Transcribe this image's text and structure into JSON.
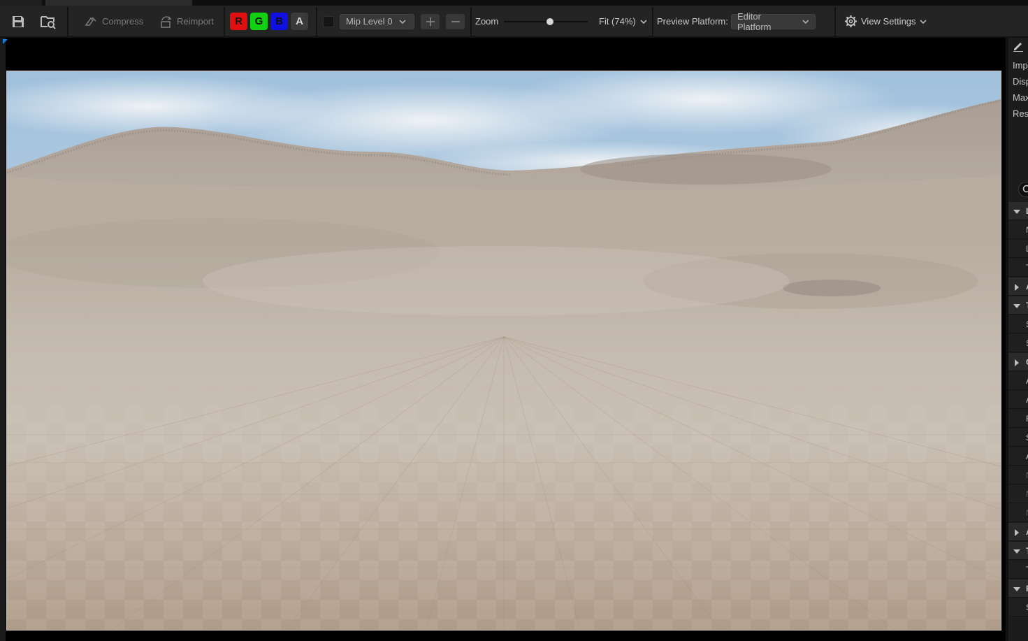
{
  "toolbar": {
    "save_icon": "save-icon",
    "browse_icon": "browse-asset-icon",
    "compress_label": "Compress",
    "reimport_label": "Reimport",
    "channels": {
      "r": "R",
      "g": "G",
      "b": "B",
      "a": "A"
    },
    "mip_level": "Mip Level 0",
    "zoom_label": "Zoom",
    "zoom_value": "Fit (74%)",
    "zoom_slider_fraction": 0.55,
    "preview_platform_label": "Preview Platform:",
    "preview_platform_value": "Editor Platform",
    "view_settings_label": "View Settings"
  },
  "details": {
    "info_rows": [
      "Imp",
      "Disp",
      "Max",
      "Res"
    ],
    "rows": [
      {
        "kind": "cat",
        "open": true,
        "ch": "L"
      },
      {
        "kind": "prop",
        "ch": "N"
      },
      {
        "kind": "prop",
        "ch": "L"
      },
      {
        "kind": "prop",
        "ch": "T"
      },
      {
        "kind": "cat",
        "open": false,
        "ch": "A"
      },
      {
        "kind": "cat",
        "open": true,
        "ch": "T"
      },
      {
        "kind": "prop",
        "ch": "S"
      },
      {
        "kind": "prop",
        "ch": "S"
      },
      {
        "kind": "cat",
        "open": false,
        "ch": "C"
      },
      {
        "kind": "prop",
        "ch": "A"
      },
      {
        "kind": "prop",
        "ch": "A"
      },
      {
        "kind": "prop",
        "ch": "F"
      },
      {
        "kind": "prop",
        "ch": "S"
      },
      {
        "kind": "prop",
        "ch": "A"
      },
      {
        "kind": "prop",
        "ch": "N",
        "faint": true
      },
      {
        "kind": "prop",
        "ch": "N",
        "faint": true
      },
      {
        "kind": "prop",
        "ch": "N",
        "faint": true
      },
      {
        "kind": "cat",
        "open": false,
        "ch": "A"
      },
      {
        "kind": "cat",
        "open": true,
        "ch": "T"
      },
      {
        "kind": "prop",
        "ch": "T"
      },
      {
        "kind": "cat",
        "open": true,
        "ch": "F"
      },
      {
        "kind": "prop",
        "ch": "S"
      }
    ]
  },
  "colors": {
    "accent": "#1a7ed8",
    "channel_r": "#e01010",
    "channel_g": "#12d012",
    "channel_b": "#1010e0"
  }
}
